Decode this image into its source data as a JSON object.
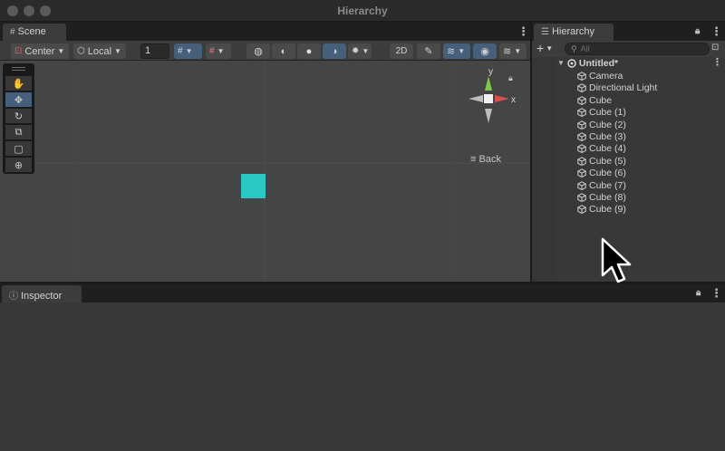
{
  "window": {
    "title": "Hierarchy"
  },
  "scene": {
    "tab_label": "Scene",
    "toolbar": {
      "pivot_label": "Center",
      "space_label": "Local",
      "grid_snap_value": "1"
    },
    "orientation_gizmo": {
      "y_axis": "y",
      "x_axis": "x",
      "back_label": "Back"
    },
    "tools": [
      "view-tool",
      "move-tool",
      "rotate-tool",
      "scale-tool",
      "rect-tool",
      "transform-tool"
    ],
    "active_tool": "move-tool",
    "cube_color": "#2bc7c4"
  },
  "hierarchy": {
    "tab_label": "Hierarchy",
    "search_placeholder": "All",
    "scene_name": "Untitled*",
    "items": [
      {
        "label": "Camera"
      },
      {
        "label": "Directional Light"
      },
      {
        "label": "Cube"
      },
      {
        "label": "Cube (1)"
      },
      {
        "label": "Cube (2)"
      },
      {
        "label": "Cube (3)"
      },
      {
        "label": "Cube (4)"
      },
      {
        "label": "Cube (5)"
      },
      {
        "label": "Cube (6)"
      },
      {
        "label": "Cube (7)"
      },
      {
        "label": "Cube (8)"
      },
      {
        "label": "Cube (9)"
      }
    ]
  },
  "inspector": {
    "tab_label": "Inspector"
  },
  "colors": {
    "accent_active": "#46607c",
    "panel_bg": "#383838",
    "viewport_bg": "#454545"
  }
}
